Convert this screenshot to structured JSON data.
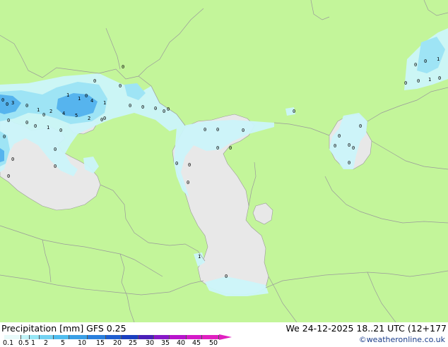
{
  "footer": {
    "title": "Precipitation [mm]  GFS 0.25",
    "datetime": "We 24-12-2025 18..21 UTC (12+177",
    "credit": "©weatheronline.co.uk"
  },
  "legend": {
    "ticks": [
      "0.1",
      "0.5",
      "1",
      "2",
      "5",
      "10",
      "15",
      "20",
      "25",
      "30",
      "35",
      "40",
      "45",
      "50"
    ],
    "colors": [
      "#e8fafa",
      "#bff2f7",
      "#96e6f5",
      "#73d2f2",
      "#50bdee",
      "#3aa0e6",
      "#2a7fdc",
      "#1f5ed0",
      "#1a3fc0",
      "#4a1fb8",
      "#8818c8",
      "#b814cc",
      "#d41ac8",
      "#e020c0"
    ]
  },
  "map": {
    "colors": {
      "land": "#c3f59a",
      "sea": "#e8e8e8",
      "precip_light": "#ccf5fa",
      "precip_mid": "#9ee4f5",
      "precip_heavy": "#56b4ee",
      "border": "#9a9a9a"
    },
    "labels": [
      "0",
      "3",
      "0",
      "1",
      "2",
      "4",
      "5",
      "1",
      "1",
      "4",
      "1",
      "2",
      "0",
      "0",
      "1",
      "0",
      "0",
      "0",
      "0",
      "0",
      "0",
      "0",
      "0",
      "0",
      "0",
      "0",
      "0",
      "0",
      "0",
      "0",
      "0",
      "0",
      "0",
      "0",
      "0",
      "0",
      "0",
      "0",
      "0",
      "0",
      "0",
      "0",
      "0",
      "0",
      "0",
      "0",
      "1",
      "0",
      "1",
      "0",
      "0",
      "1",
      "0",
      "0",
      "0",
      "0",
      "0",
      "0",
      "0"
    ]
  }
}
